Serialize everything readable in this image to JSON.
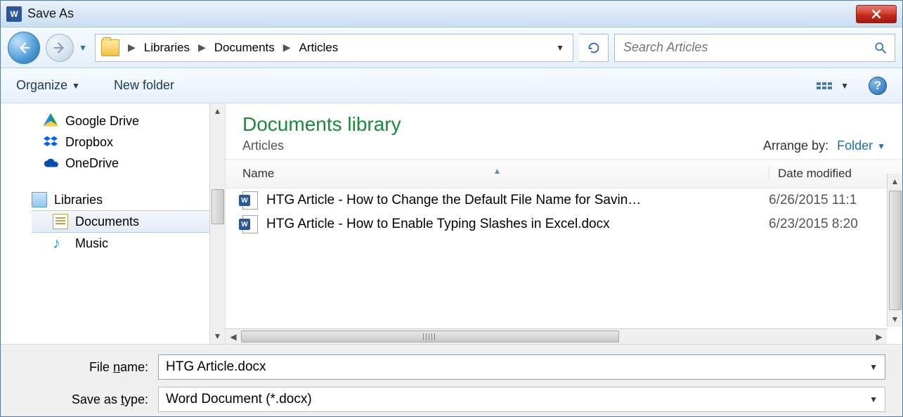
{
  "titlebar": {
    "title": "Save As"
  },
  "breadcrumb": {
    "items": [
      "Libraries",
      "Documents",
      "Articles"
    ]
  },
  "search": {
    "placeholder": "Search Articles"
  },
  "toolbar": {
    "organize": "Organize",
    "newfolder": "New folder"
  },
  "sidebar": {
    "items": [
      {
        "label": "Google Drive",
        "icon": "gdrive"
      },
      {
        "label": "Dropbox",
        "icon": "dropbox"
      },
      {
        "label": "OneDrive",
        "icon": "onedrive"
      }
    ],
    "lib_label": "Libraries",
    "lib_items": [
      {
        "label": "Documents",
        "selected": true
      },
      {
        "label": "Music"
      }
    ]
  },
  "library": {
    "title": "Documents library",
    "subtitle": "Articles",
    "arrange_label": "Arrange by:",
    "arrange_value": "Folder"
  },
  "columns": {
    "name": "Name",
    "date": "Date modified"
  },
  "files": [
    {
      "name": "HTG Article - How to Change the Default File Name for Savin…",
      "date": "6/26/2015 11:1"
    },
    {
      "name": "HTG Article - How to Enable Typing Slashes in Excel.docx",
      "date": "6/23/2015 8:20"
    }
  ],
  "fields": {
    "filename_label_pre": "File ",
    "filename_label_ul": "n",
    "filename_label_post": "ame:",
    "filename_value": "HTG Article.docx",
    "savetype_label_pre": "Save as ",
    "savetype_label_ul": "t",
    "savetype_label_post": "ype:",
    "savetype_value": "Word Document (*.docx)"
  }
}
